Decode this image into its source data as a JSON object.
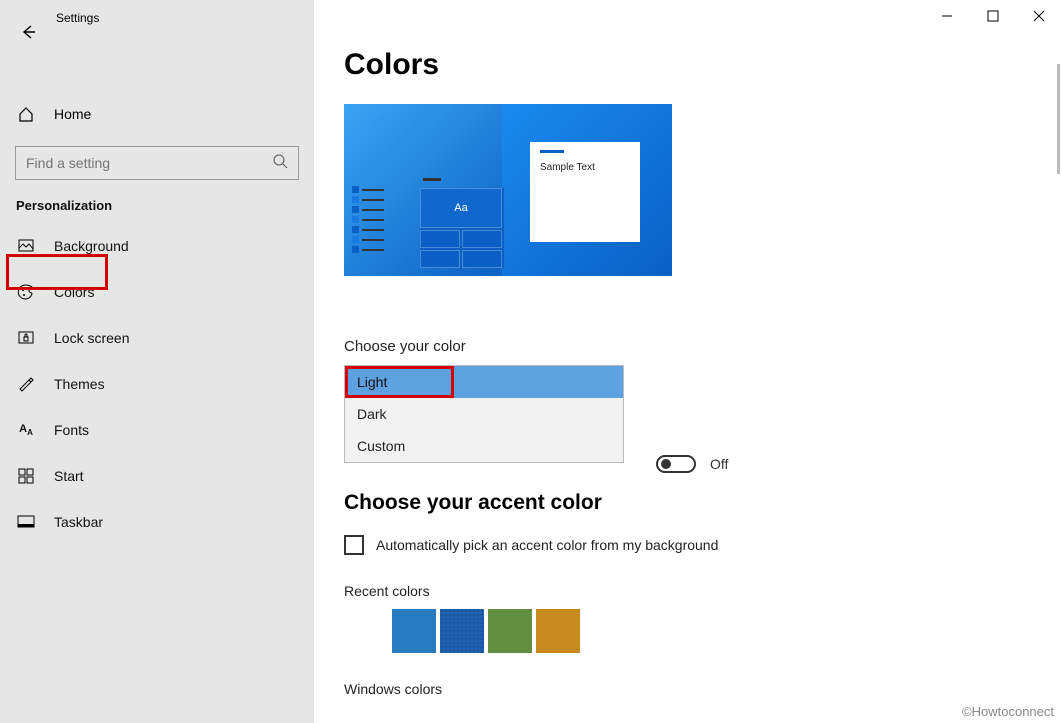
{
  "app": {
    "title": "Settings"
  },
  "titlebar": {
    "min": "—",
    "max": "☐",
    "close": "✕"
  },
  "sidebar": {
    "home": "Home",
    "search_placeholder": "Find a setting",
    "category": "Personalization",
    "items": [
      {
        "label": "Background"
      },
      {
        "label": "Colors"
      },
      {
        "label": "Lock screen"
      },
      {
        "label": "Themes"
      },
      {
        "label": "Fonts"
      },
      {
        "label": "Start"
      },
      {
        "label": "Taskbar"
      }
    ]
  },
  "main": {
    "title": "Colors",
    "preview": {
      "sample_text": "Sample Text",
      "tile_text": "Aa"
    },
    "color_mode": {
      "label": "Choose your color",
      "options": [
        "Light",
        "Dark",
        "Custom"
      ],
      "selected": "Light"
    },
    "transparency_toggle": {
      "value": "Off"
    },
    "accent": {
      "title": "Choose your accent color",
      "auto_label": "Automatically pick an accent color from my background"
    },
    "recent": {
      "label": "Recent colors",
      "colors": [
        "#0078d7",
        "#2a7cc0",
        "#2060b0",
        "#628f3f",
        "#b97a1f"
      ]
    },
    "windows_colors_label": "Windows colors"
  },
  "watermark": "©Howtoconnect"
}
